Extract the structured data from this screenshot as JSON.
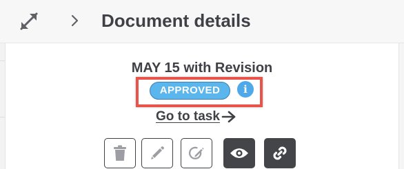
{
  "header": {
    "title": "Document details",
    "expand_icon": "expand-arrows-icon",
    "chevron_icon": "chevron-right-icon"
  },
  "document": {
    "name": "MAY 15 with Revision",
    "status": "APPROVED",
    "status_color": "#5ab6ec",
    "info_icon": "info-icon",
    "go_to_task_label": "Go to task",
    "highlight_color": "#e8544a"
  },
  "actions": [
    {
      "name": "delete",
      "icon": "trash-icon",
      "style": "light"
    },
    {
      "name": "edit",
      "icon": "pencil-icon",
      "style": "light"
    },
    {
      "name": "sign",
      "icon": "signature-icon",
      "style": "light"
    },
    {
      "name": "view",
      "icon": "eye-icon",
      "style": "dark"
    },
    {
      "name": "link",
      "icon": "link-icon",
      "style": "dark"
    }
  ]
}
